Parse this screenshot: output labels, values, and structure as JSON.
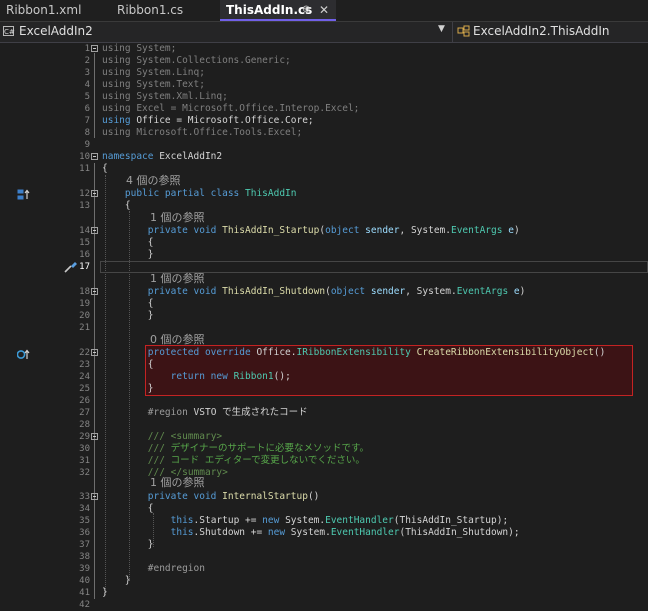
{
  "tabs": [
    {
      "label": "Ribbon1.xml",
      "active": false
    },
    {
      "label": "Ribbon1.cs",
      "active": false
    },
    {
      "label": "ThisAddIn.cs",
      "active": true,
      "pin": "⊕",
      "close": "✕"
    }
  ],
  "navbar": {
    "project": "ExcelAddIn2",
    "project_icon": "C#",
    "member": "ExcelAddIn2.ThisAddIn"
  },
  "lens": {
    "ref4": "4 個の参照",
    "ref1a": "1 個の参照",
    "ref1b": "1 個の参照",
    "ref0": "0 個の参照",
    "ref1c": "1 個の参照"
  },
  "lines": {
    "l1": [
      "using",
      " System;"
    ],
    "l2": [
      "using",
      " System.Collections.Generic;"
    ],
    "l3": [
      "using",
      " System.Linq;"
    ],
    "l4": [
      "using",
      " System.Text;"
    ],
    "l5": [
      "using",
      " System.Xml.Linq;"
    ],
    "l6": [
      "using",
      " Excel = Microsoft.Office.Interop.Excel;"
    ],
    "l7": [
      "using",
      " Office = Microsoft.Office.Core;"
    ],
    "l8": [
      "using",
      " Microsoft.Office.Tools.Excel;"
    ],
    "l10": [
      "namespace",
      " ExcelAddIn2"
    ],
    "l11": "{",
    "l12": [
      "public partial class",
      " ",
      "ThisAddIn"
    ],
    "l13": "{",
    "l14": [
      "private void",
      " ",
      "ThisAddIn_Startup",
      "(",
      "object",
      " ",
      "sender",
      ", System.",
      "EventArgs",
      " ",
      "e",
      ")"
    ],
    "l15": "{",
    "l16": "}",
    "l18": [
      "private void",
      " ",
      "ThisAddIn_Shutdown",
      "(",
      "object",
      " ",
      "sender",
      ", System.",
      "EventArgs",
      " ",
      "e",
      ")"
    ],
    "l19": "{",
    "l20": "}",
    "l22": [
      "protected override",
      " Office.",
      "IRibbonExtensibility",
      " ",
      "CreateRibbonExtensibilityObject",
      "()"
    ],
    "l23": "{",
    "l24": [
      "return new",
      " ",
      "Ribbon1",
      "();"
    ],
    "l25": "}",
    "l27": [
      "#region",
      " VSTO で生成されたコード"
    ],
    "l29": [
      "///",
      " <summary>"
    ],
    "l30": [
      "///",
      " デザイナーのサポートに必要なメソッドです。"
    ],
    "l31": [
      "///",
      " コード エディターで変更しないでください。"
    ],
    "l32": [
      "///",
      " </summary>"
    ],
    "l33": [
      "private void",
      " ",
      "InternalStartup",
      "()"
    ],
    "l34": "{",
    "l35": [
      "this",
      ".Startup += ",
      "new",
      " System.",
      "EventHandler",
      "(",
      "ThisAddIn_Startup",
      ");"
    ],
    "l36": [
      "this",
      ".Shutdown += ",
      "new",
      " System.",
      "EventHandler",
      "(",
      "ThisAddIn_Shutdown",
      ");"
    ],
    "l37": "}",
    "l39": "#endregion",
    "l40": "}",
    "l41": "}"
  },
  "line_numbers": [
    "1",
    "2",
    "3",
    "4",
    "5",
    "6",
    "7",
    "8",
    "9",
    "10",
    "11",
    "12",
    "13",
    "14",
    "15",
    "16",
    "17",
    "18",
    "19",
    "20",
    "21",
    "22",
    "23",
    "24",
    "25",
    "26",
    "27",
    "28",
    "29",
    "30",
    "31",
    "32",
    "33",
    "34",
    "35",
    "36",
    "37",
    "38",
    "39",
    "40",
    "41",
    "42"
  ],
  "colors": {
    "keyword": "#569cd6",
    "type": "#4ec9b0",
    "method": "#dcdcaa",
    "param": "#9cdcfe",
    "comment": "#57a64a",
    "highlight_border": "#c42323",
    "active_tab_accent": "#7160e8"
  }
}
